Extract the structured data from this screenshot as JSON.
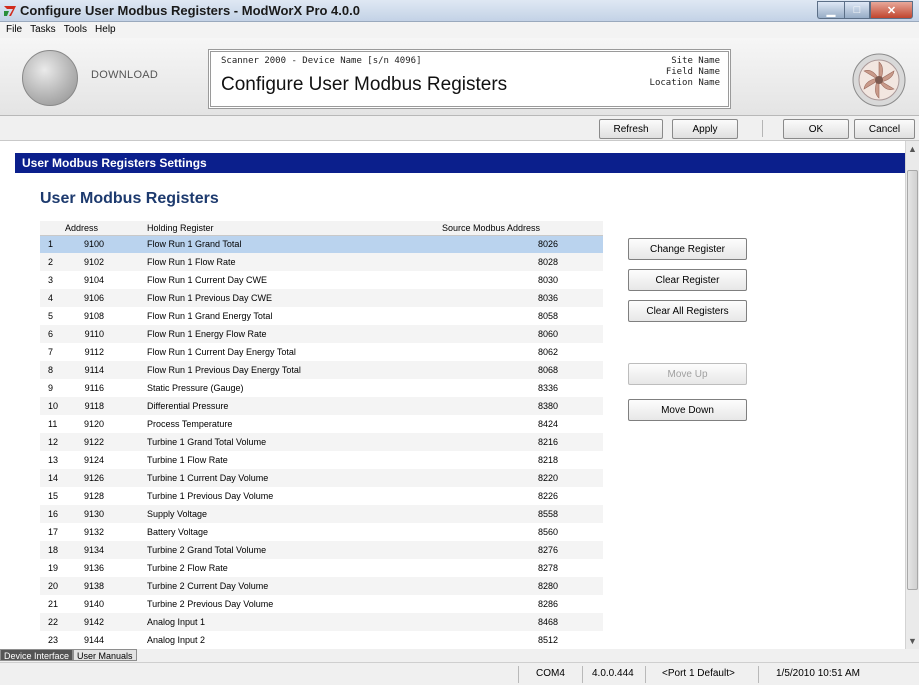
{
  "window": {
    "title": "Configure User Modbus Registers - ModWorX Pro 4.0.0"
  },
  "menu": [
    "File",
    "Tasks",
    "Tools",
    "Help"
  ],
  "header": {
    "download_label": "DOWNLOAD",
    "device_line": "Scanner 2000 - Device Name [s/n 4096]",
    "page_title": "Configure User Modbus Registers",
    "site_name": "Site Name",
    "field_name": "Field Name",
    "location_name": "Location Name"
  },
  "toolbar": {
    "refresh": "Refresh",
    "apply": "Apply",
    "ok": "OK",
    "cancel": "Cancel"
  },
  "section": {
    "bar_title": "User Modbus Registers Settings",
    "heading": "User Modbus Registers"
  },
  "table": {
    "headers": [
      "",
      "Address",
      "Holding Register",
      "Source Modbus Address"
    ],
    "selected_row": 0,
    "rows": [
      {
        "num": "1",
        "address": "9100",
        "register": "Flow Run 1 Grand Total",
        "source": "8026"
      },
      {
        "num": "2",
        "address": "9102",
        "register": "Flow Run 1 Flow Rate",
        "source": "8028"
      },
      {
        "num": "3",
        "address": "9104",
        "register": "Flow Run 1 Current Day CWE",
        "source": "8030"
      },
      {
        "num": "4",
        "address": "9106",
        "register": "Flow Run 1 Previous Day CWE",
        "source": "8036"
      },
      {
        "num": "5",
        "address": "9108",
        "register": "Flow Run 1 Grand Energy Total",
        "source": "8058"
      },
      {
        "num": "6",
        "address": "9110",
        "register": "Flow Run 1 Energy Flow Rate",
        "source": "8060"
      },
      {
        "num": "7",
        "address": "9112",
        "register": "Flow Run 1 Current Day Energy Total",
        "source": "8062"
      },
      {
        "num": "8",
        "address": "9114",
        "register": "Flow Run 1 Previous Day Energy Total",
        "source": "8068"
      },
      {
        "num": "9",
        "address": "9116",
        "register": "Static Pressure (Gauge)",
        "source": "8336"
      },
      {
        "num": "10",
        "address": "9118",
        "register": "Differential Pressure",
        "source": "8380"
      },
      {
        "num": "11",
        "address": "9120",
        "register": "Process Temperature",
        "source": "8424"
      },
      {
        "num": "12",
        "address": "9122",
        "register": "Turbine 1 Grand Total Volume",
        "source": "8216"
      },
      {
        "num": "13",
        "address": "9124",
        "register": "Turbine 1 Flow Rate",
        "source": "8218"
      },
      {
        "num": "14",
        "address": "9126",
        "register": "Turbine 1 Current Day Volume",
        "source": "8220"
      },
      {
        "num": "15",
        "address": "9128",
        "register": "Turbine 1 Previous Day Volume",
        "source": "8226"
      },
      {
        "num": "16",
        "address": "9130",
        "register": "Supply Voltage",
        "source": "8558"
      },
      {
        "num": "17",
        "address": "9132",
        "register": "Battery Voltage",
        "source": "8560"
      },
      {
        "num": "18",
        "address": "9134",
        "register": "Turbine 2 Grand Total Volume",
        "source": "8276"
      },
      {
        "num": "19",
        "address": "9136",
        "register": "Turbine 2 Flow Rate",
        "source": "8278"
      },
      {
        "num": "20",
        "address": "9138",
        "register": "Turbine 2 Current Day Volume",
        "source": "8280"
      },
      {
        "num": "21",
        "address": "9140",
        "register": "Turbine 2 Previous Day Volume",
        "source": "8286"
      },
      {
        "num": "22",
        "address": "9142",
        "register": "Analog Input 1",
        "source": "8468"
      },
      {
        "num": "23",
        "address": "9144",
        "register": "Analog Input 2",
        "source": "8512"
      }
    ]
  },
  "side_buttons": {
    "change_register": "Change Register",
    "clear_register": "Clear Register",
    "clear_all_registers": "Clear All Registers",
    "move_up": "Move Up",
    "move_down": "Move Down"
  },
  "bottom_tabs": [
    "Device Interface",
    "User Manuals"
  ],
  "status": {
    "port": "COM4",
    "version": "4.0.0.444",
    "port_default": "<Port 1 Default>",
    "datetime": "1/5/2010 10:51 AM"
  },
  "colors": {
    "section_bar": "#0b1f8c",
    "heading": "#1d3a6e",
    "selected_row": "#bad3ee"
  }
}
